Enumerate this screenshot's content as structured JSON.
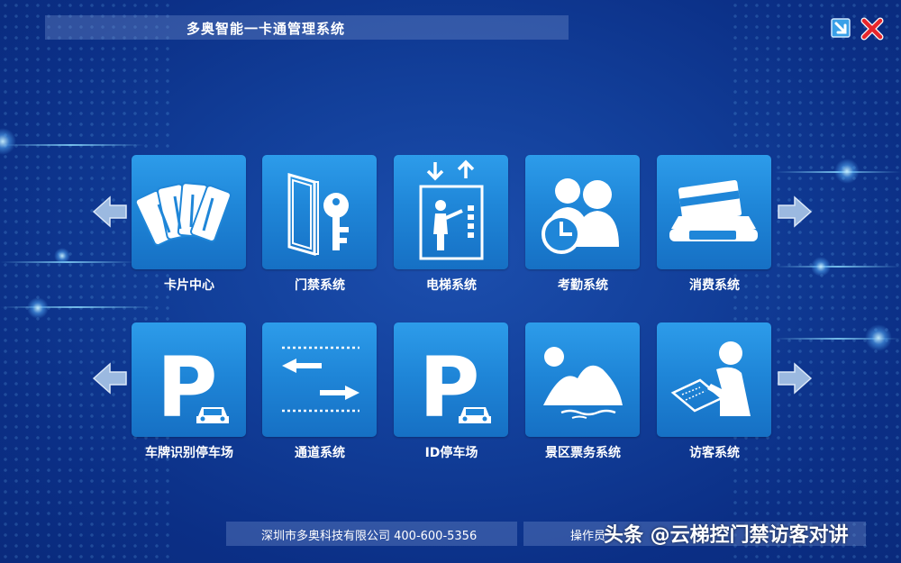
{
  "window": {
    "title": "多奥智能一卡通管理系统",
    "minimize_icon": "minimize-arrow-icon",
    "close_icon": "close-x-icon"
  },
  "nav": {
    "prev_icon": "arrow-left-icon",
    "next_icon": "arrow-right-icon"
  },
  "modules_row1": [
    {
      "label": "卡片中心",
      "icon": "cards-icon"
    },
    {
      "label": "门禁系统",
      "icon": "door-key-icon"
    },
    {
      "label": "电梯系统",
      "icon": "elevator-icon"
    },
    {
      "label": "考勤系统",
      "icon": "attendance-clock-icon"
    },
    {
      "label": "消费系统",
      "icon": "pos-card-reader-icon"
    }
  ],
  "modules_row2": [
    {
      "label": "车牌识别停车场",
      "icon": "parking-icon"
    },
    {
      "label": "通道系统",
      "icon": "channel-arrows-icon"
    },
    {
      "label": "ID停车场",
      "icon": "parking-icon"
    },
    {
      "label": "景区票务系统",
      "icon": "scenic-mountain-icon"
    },
    {
      "label": "访客系统",
      "icon": "visitor-sign-icon"
    }
  ],
  "footer": {
    "company": "深圳市多奥科技有限公司 400-600-5356",
    "operator": "操作员"
  },
  "watermark": "头条 @云梯控门禁访客对讲",
  "colors": {
    "background": "#123f9a",
    "tile": "#2088d9",
    "text": "#ffffff"
  }
}
